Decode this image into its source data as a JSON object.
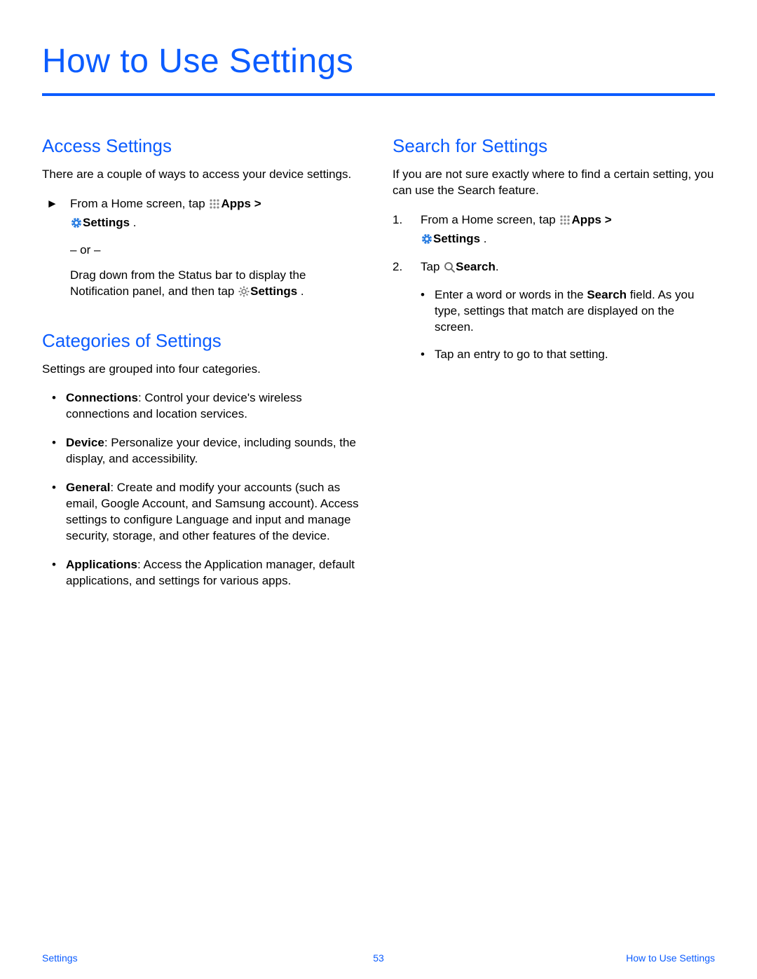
{
  "title": "How to Use Settings",
  "left": {
    "section1": {
      "heading": "Access Settings",
      "intro": "There are a couple of ways to access your device settings.",
      "step_prefix": "From a Home screen, tap ",
      "apps_label": "Apps > ",
      "settings_label": "Settings",
      "period": " .",
      "or": "– or –",
      "alt_prefix": "Drag down from the Status bar to display the Notification panel, and then tap ",
      "alt_settings": "Settings",
      "alt_period": " ."
    },
    "section2": {
      "heading": "Categories of Settings",
      "intro": "Settings are grouped into four categories.",
      "items": [
        {
          "name": "Connections",
          "desc": ": Control your device's wireless connections and location services."
        },
        {
          "name": "Device",
          "desc": ": Personalize your device, including sounds, the display, and accessibility."
        },
        {
          "name": "General",
          "desc": ": Create and modify your accounts (such as email, Google Account, and Samsung account). Access settings to configure Language and input and manage security, storage, and other features of the device."
        },
        {
          "name": "Applications",
          "desc": ": Access the Application manager, default applications, and settings for various apps."
        }
      ]
    }
  },
  "right": {
    "section1": {
      "heading": "Search for Settings",
      "intro": "If you are not sure exactly where to find a certain setting, you can use the Search feature.",
      "step1_num": "1.",
      "step1_prefix": "From a Home screen, tap ",
      "apps_label": "Apps > ",
      "settings_label": "Settings",
      "period": " .",
      "step2_num": "2.",
      "step2_prefix": "Tap ",
      "search_label": "Search",
      "step2_period": ".",
      "sub1_a": "Enter a word or words in the ",
      "sub1_b": "Search",
      "sub1_c": " field. As you type, settings that match are displayed on the screen.",
      "sub2": "Tap an entry to go to that setting."
    }
  },
  "footer": {
    "left": "Settings",
    "center": "53",
    "right": "How to Use Settings"
  }
}
